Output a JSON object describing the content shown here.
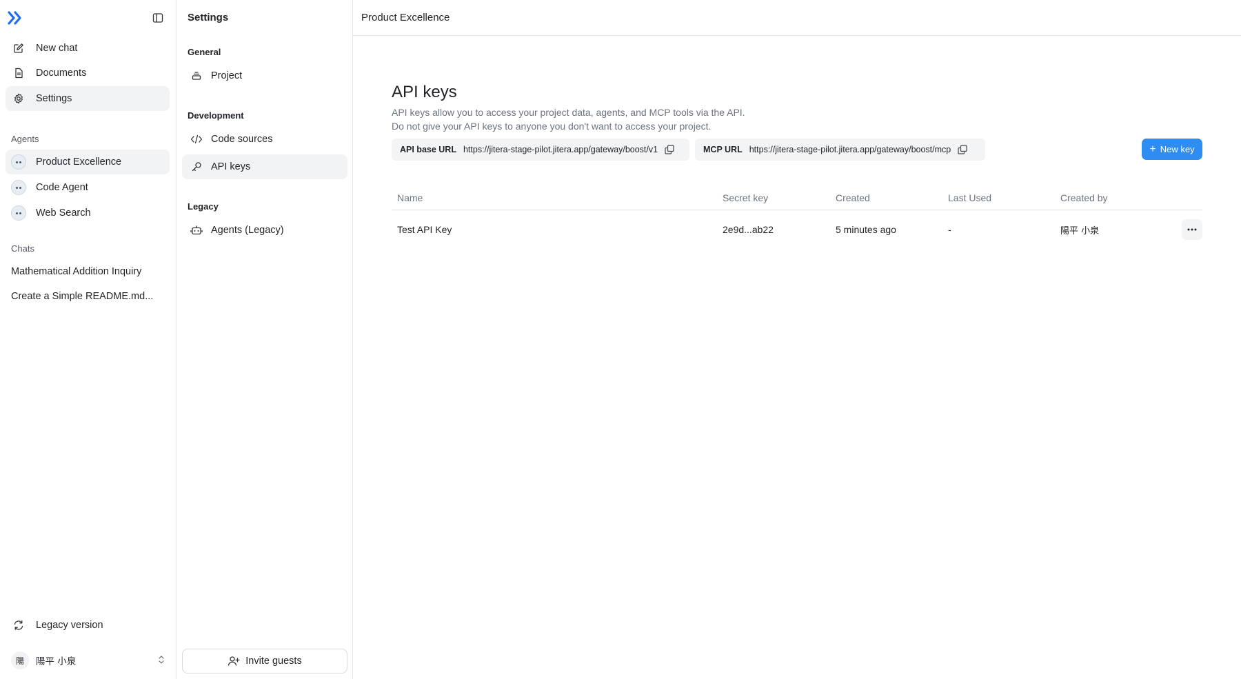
{
  "sidebar": {
    "nav": [
      {
        "label": "New chat",
        "icon": "edit-icon"
      },
      {
        "label": "Documents",
        "icon": "document-icon"
      },
      {
        "label": "Settings",
        "icon": "gear-icon"
      }
    ],
    "agents_label": "Agents",
    "agents": [
      {
        "label": "Product Excellence"
      },
      {
        "label": "Code Agent"
      },
      {
        "label": "Web Search"
      }
    ],
    "chats_label": "Chats",
    "chats": [
      {
        "label": "Mathematical Addition Inquiry"
      },
      {
        "label": "Create a Simple README.md..."
      }
    ],
    "legacy_version_label": "Legacy version",
    "user": {
      "avatar_initial": "陽",
      "name": "陽平 小泉"
    }
  },
  "settings": {
    "title": "Settings",
    "sections": [
      {
        "label": "General",
        "items": [
          {
            "label": "Project"
          }
        ]
      },
      {
        "label": "Development",
        "items": [
          {
            "label": "Code sources"
          },
          {
            "label": "API keys"
          }
        ]
      },
      {
        "label": "Legacy",
        "items": [
          {
            "label": "Agents (Legacy)"
          }
        ]
      }
    ],
    "invite_label": "Invite guests"
  },
  "main": {
    "breadcrumb": "Product Excellence",
    "title": "API keys",
    "description_line1": "API keys allow you to access your project data, agents, and MCP tools via the API.",
    "description_line2": "Do not give your API keys to anyone you don't want to access your project.",
    "api_base": {
      "label": "API base URL",
      "value": "https://jitera-stage-pilot.jitera.app/gateway/boost/v1"
    },
    "mcp": {
      "label": "MCP URL",
      "value": "https://jitera-stage-pilot.jitera.app/gateway/boost/mcp"
    },
    "new_key_label": "New key",
    "table": {
      "columns": [
        "Name",
        "Secret key",
        "Created",
        "Last Used",
        "Created by"
      ],
      "rows": [
        {
          "name": "Test API Key",
          "secret": "2e9d...ab22",
          "created": "5 minutes ago",
          "last_used": "-",
          "created_by": "陽平 小泉"
        }
      ]
    }
  },
  "colors": {
    "accent": "#2f8cf0",
    "logo": "#1f6bf0"
  }
}
